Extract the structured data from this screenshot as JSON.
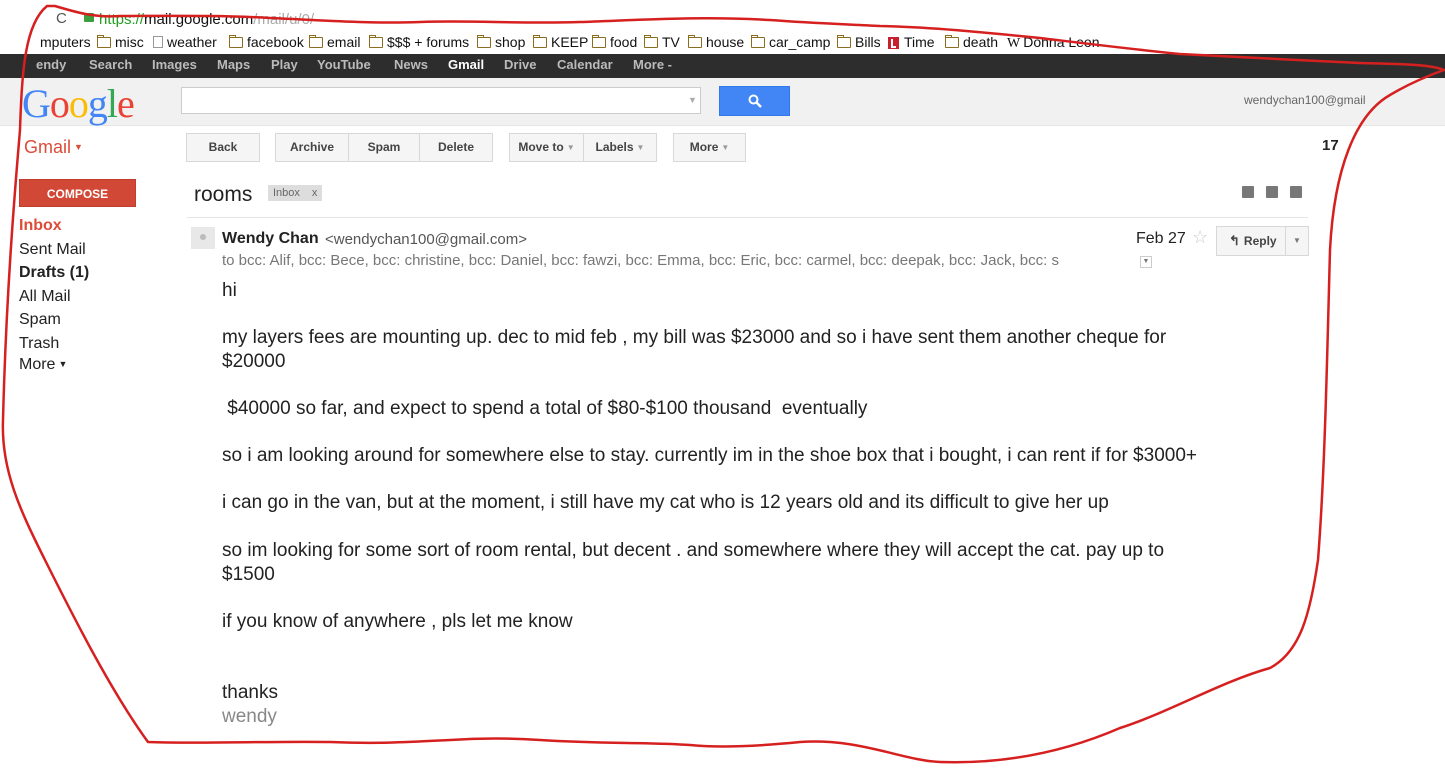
{
  "browser": {
    "url_scheme": "https://",
    "url_host": "mail.google.com",
    "url_path": "/mail/u/0/"
  },
  "bookmarks": [
    {
      "label": "mputers",
      "icon": "folder-icon"
    },
    {
      "label": "misc",
      "icon": "folder-icon"
    },
    {
      "label": "weather",
      "icon": "page-icon"
    },
    {
      "label": "facebook",
      "icon": "folder-icon"
    },
    {
      "label": "email",
      "icon": "folder-icon"
    },
    {
      "label": "$$$ + forums",
      "icon": "folder-icon"
    },
    {
      "label": "shop",
      "icon": "folder-icon"
    },
    {
      "label": "KEEP",
      "icon": "folder-icon"
    },
    {
      "label": "food",
      "icon": "folder-icon"
    },
    {
      "label": "TV",
      "icon": "folder-icon"
    },
    {
      "label": "house",
      "icon": "folder-icon"
    },
    {
      "label": "car_camp",
      "icon": "folder-icon"
    },
    {
      "label": "Bills",
      "icon": "folder-icon"
    },
    {
      "label": "Time",
      "icon": "time-icon"
    },
    {
      "label": "death",
      "icon": "folder-icon"
    },
    {
      "label": "Donna Leon",
      "icon": "wikipedia-icon"
    }
  ],
  "google_bar": [
    "endy",
    "Search",
    "Images",
    "Maps",
    "Play",
    "YouTube",
    "News",
    "Gmail",
    "Drive",
    "Calendar",
    "More -"
  ],
  "google_bar_active": "Gmail",
  "header": {
    "logo": "Google",
    "account_email": "wendychan100@gmail"
  },
  "toolbar": {
    "app_label": "Gmail",
    "back": "Back",
    "archive": "Archive",
    "spam": "Spam",
    "delete": "Delete",
    "move_to": "Move to",
    "labels": "Labels",
    "more": "More",
    "page_count": "17"
  },
  "sidebar": {
    "compose": "COMPOSE",
    "items": [
      {
        "label": "Inbox"
      },
      {
        "label": "Sent Mail"
      },
      {
        "label": "Drafts (1)"
      },
      {
        "label": "All Mail"
      },
      {
        "label": "Spam"
      },
      {
        "label": "Trash"
      },
      {
        "label": "More"
      }
    ]
  },
  "message": {
    "subject": "rooms",
    "label": "Inbox",
    "label_remove": "x",
    "sender_name": "Wendy Chan",
    "sender_email": "<wendychan100@gmail.com>",
    "date": "Feb 27",
    "reply": "Reply",
    "recipients": "to bcc: Alif, bcc: Bece, bcc: christine, bcc: Daniel, bcc: fawzi, bcc: Emma, bcc: Eric, bcc: carmel, bcc: deepak, bcc: Jack, bcc: s",
    "body": [
      "hi",
      "my layers fees are mounting up. dec to mid feb , my bill was $23000 and so i have sent them another cheque for",
      "$20000",
      " $40000 so far, and expect to spend a total of $80-$100 thousand  eventually",
      "so i am looking around for somewhere else to stay. currently im in the shoe box that i bought, i can rent if for $3000+",
      "i can go in the van, but at the moment, i still have my cat who is 12 years old and its difficult to give her up",
      "so im looking for some sort of room rental, but decent . and somewhere where they will accept the cat. pay up to",
      "$1500",
      "if you know of anywhere , pls let me know",
      "thanks"
    ],
    "signature": "wendy"
  },
  "colors": {
    "gmail_red": "#dd4b39",
    "compose_red": "#d14836",
    "search_blue": "#4285f4",
    "annotation_red": "#d62020",
    "google_bar": "#2d2d2d"
  }
}
